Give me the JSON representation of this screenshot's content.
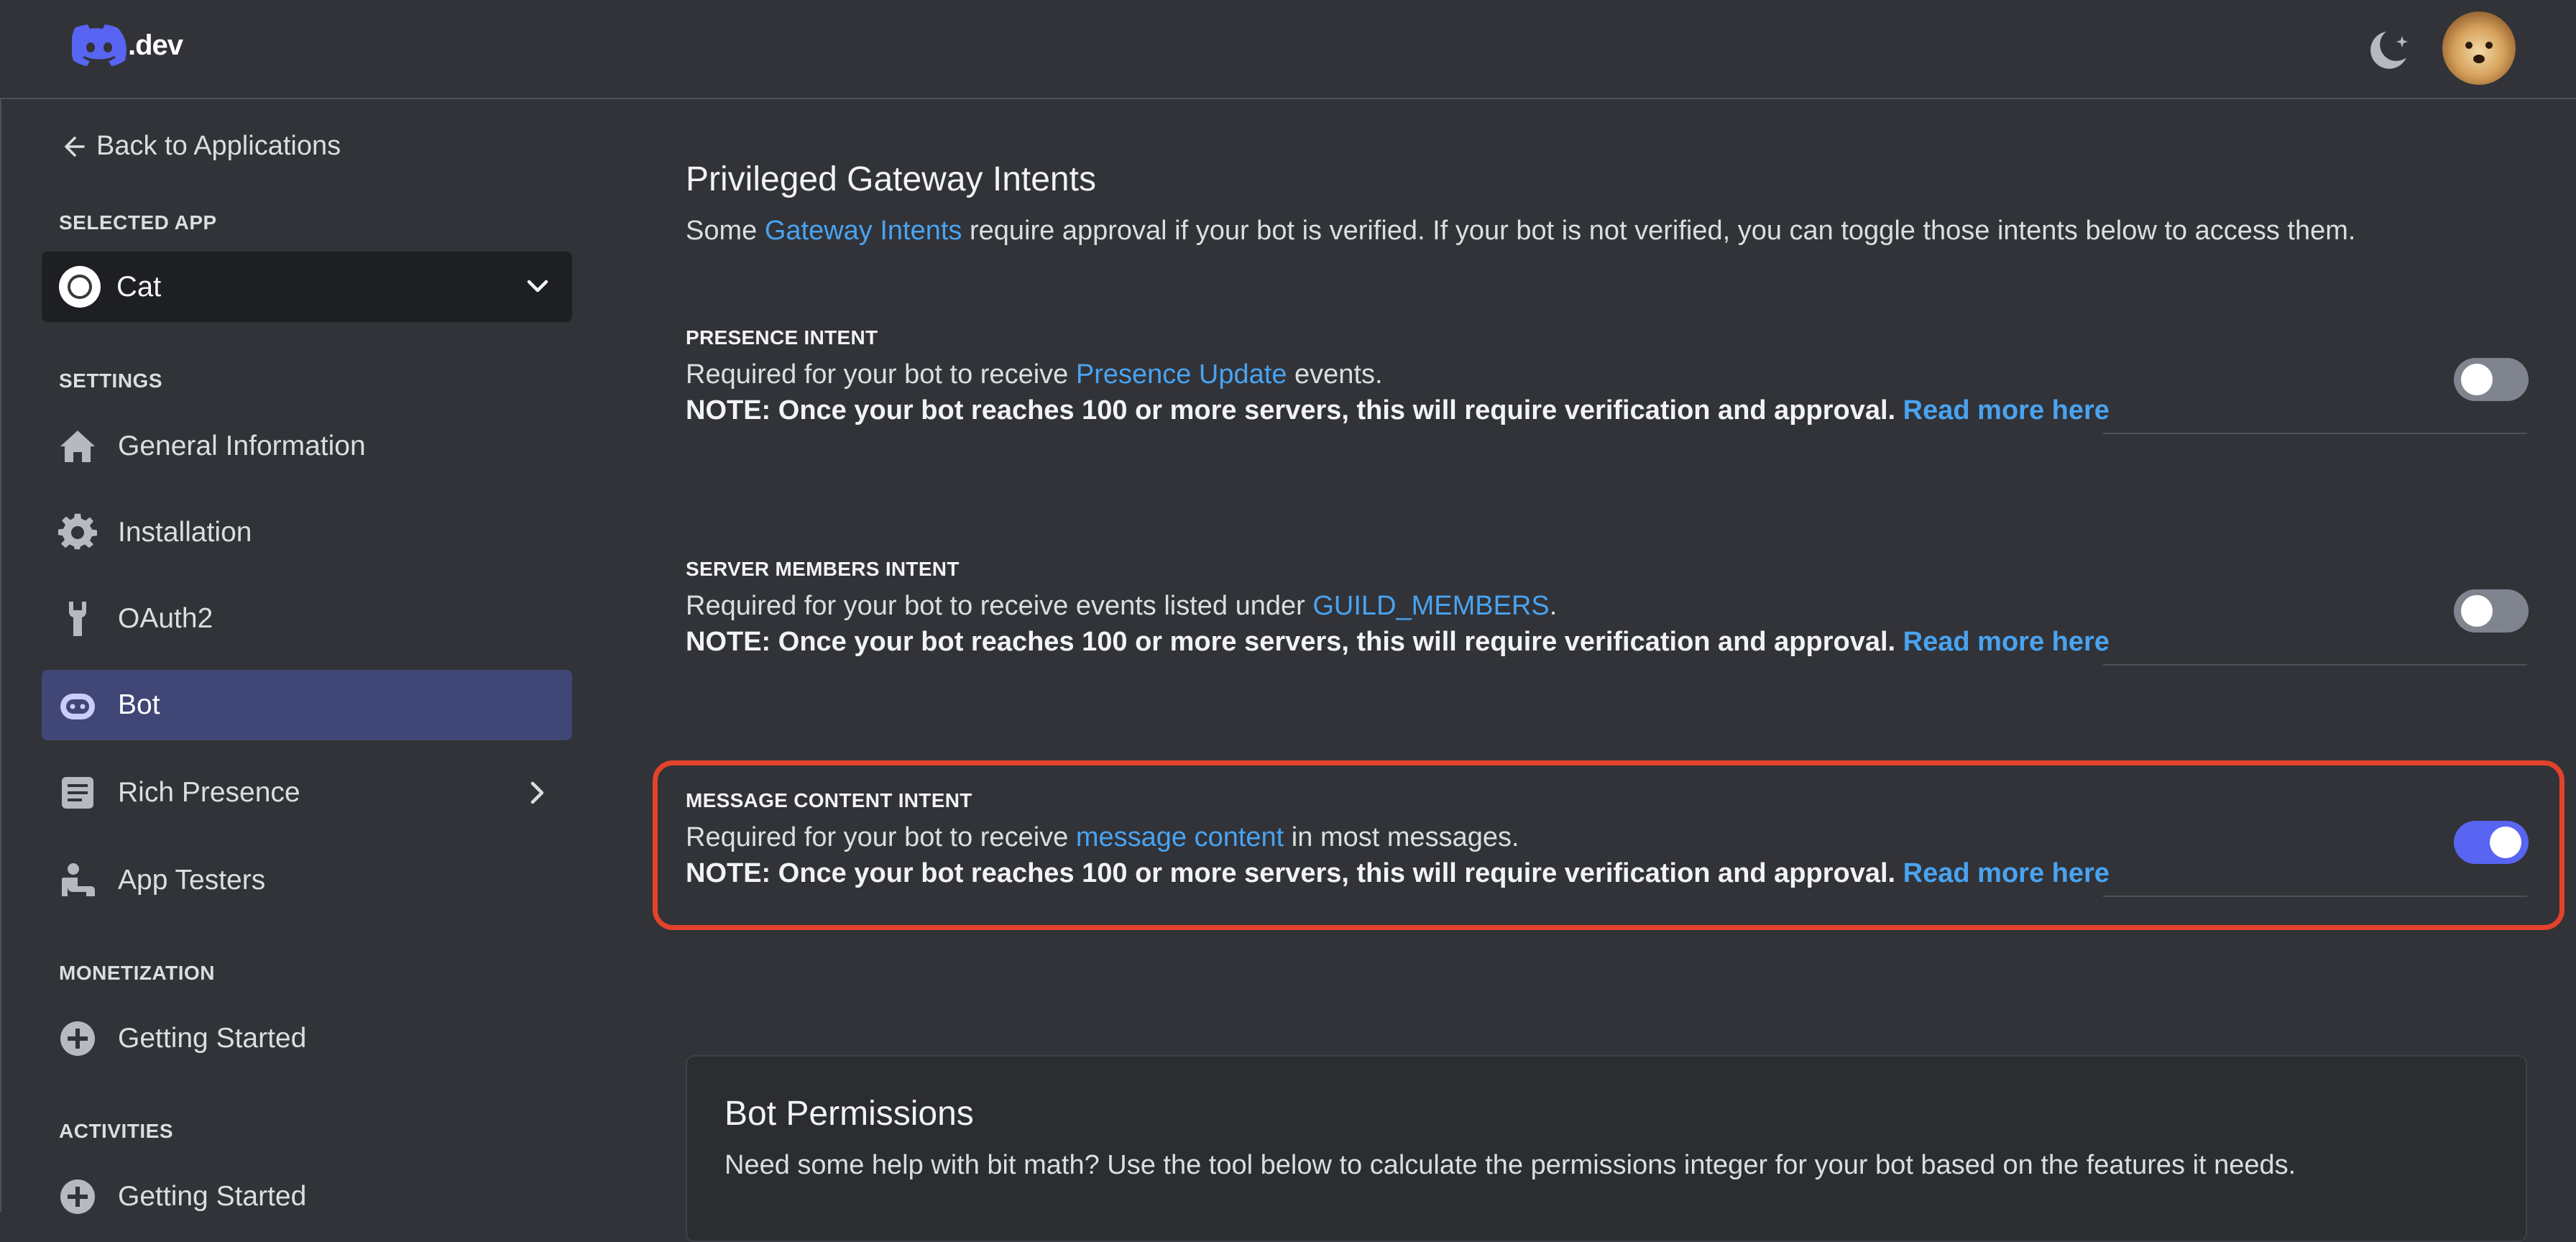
{
  "topbar": {
    "logo_text": ".dev",
    "theme_icon": "moon-stars-icon",
    "avatar": "user-avatar"
  },
  "sidebar": {
    "back_label": "Back to Applications",
    "selected_app_heading": "SELECTED APP",
    "selected_app": "Cat",
    "settings_heading": "SETTINGS",
    "items": [
      {
        "label": "General Information",
        "icon": "home-icon"
      },
      {
        "label": "Installation",
        "icon": "gear-icon"
      },
      {
        "label": "OAuth2",
        "icon": "wrench-icon"
      },
      {
        "label": "Bot",
        "icon": "bot-icon",
        "active": true
      },
      {
        "label": "Rich Presence",
        "icon": "document-icon"
      },
      {
        "label": "App Testers",
        "icon": "person-icon"
      }
    ],
    "monetization_heading": "MONETIZATION",
    "monetization_item": "Getting Started",
    "activities_heading": "ACTIVITIES",
    "activities_item": "Getting Started"
  },
  "main": {
    "title": "Privileged Gateway Intents",
    "desc_pre": "Some ",
    "desc_link": "Gateway Intents",
    "desc_post": " require approval if your bot is verified. If your bot is not verified, you can toggle those intents below to access them.",
    "note": "NOTE: Once your bot reaches 100 or more servers, this will require verification and approval. ",
    "read_more": "Read more here",
    "intents": [
      {
        "label": "PRESENCE INTENT",
        "pre": "Required for your bot to receive ",
        "link": "Presence Update",
        "post": " events.",
        "enabled": false
      },
      {
        "label": "SERVER MEMBERS INTENT",
        "pre": "Required for your bot to receive events listed under ",
        "link": "GUILD_MEMBERS",
        "post": ".",
        "enabled": false
      },
      {
        "label": "MESSAGE CONTENT INTENT",
        "pre": "Required for your bot to receive ",
        "link": "message content",
        "post": " in most messages.",
        "enabled": true
      }
    ],
    "permissions": {
      "title": "Bot Permissions",
      "desc": "Need some help with bit math? Use the tool below to calculate the permissions integer for your bot based on the features it needs."
    }
  },
  "colors": {
    "accent": "#5865f2",
    "link": "#4aa3f0",
    "highlight": "#e3432a"
  }
}
